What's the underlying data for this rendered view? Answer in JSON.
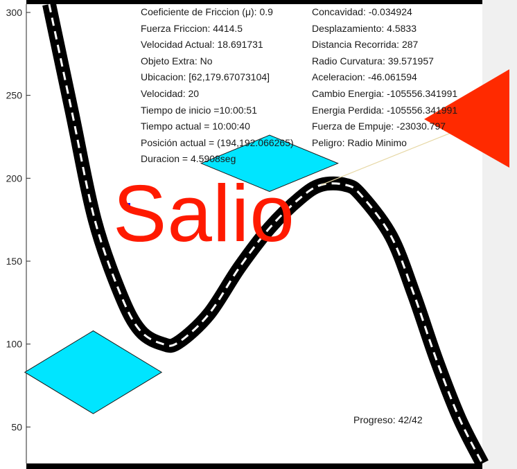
{
  "chart_data": {
    "type": "line",
    "title": "",
    "xlabel": "",
    "ylabel": "",
    "ylim": [
      28,
      305
    ],
    "yticks": [
      50,
      100,
      150,
      200,
      250,
      300
    ],
    "series": [
      {
        "x": [
          15,
          30,
          45,
          62,
          75,
          90,
          100,
          120,
          140,
          160,
          180,
          194,
          210,
          220,
          240,
          255,
          270,
          285,
          300
        ],
        "values": [
          305,
          240,
          175,
          130,
          108,
          100,
          101,
          118,
          146,
          170,
          188,
          196,
          196,
          190,
          165,
          130,
          90,
          55,
          28
        ]
      }
    ],
    "markers": [
      {
        "shape": "diamond",
        "color": "#00e5ff",
        "x_center": 160,
        "y_center": 209,
        "width": 90,
        "height": 34
      },
      {
        "shape": "diamond",
        "color": "#00e5ff",
        "x_center": 44,
        "y_center": 83,
        "width": 90,
        "height": 50
      },
      {
        "shape": "triangle",
        "color": "#ff2a00"
      }
    ]
  },
  "status_left": [
    "Coeficiente de Friccion (μ): 0.9",
    "Fuerza Friccion: 4414.5",
    "Velocidad Actual: 18.691731",
    "Objeto Extra: No",
    "Ubicacion: [62,179.67073104]",
    "Velocidad: 20",
    "Tiempo de inicio =10:00:51",
    "Tiempo actual = 10:00:40",
    "Posición actual = (194,192.066265)",
    "Duracion = 4.5908seg"
  ],
  "status_right": [
    "Concavidad: -0.034924",
    "Desplazamiento: 4.5833",
    "Distancia Recorrida: 287",
    "Radio Curvatura: 39.571957",
    "Aceleracion: -46.061594",
    "Cambio Energia: -105556.341991",
    "Energia Perdida: -105556.341991",
    "Fuerza de Empuje: -23030.797",
    "Peligro: Radio Minimo"
  ],
  "overlay_text": "Salio",
  "progress_text": "Progreso: 42/42",
  "colors": {
    "road": "#000000",
    "road_dash": "#ffffff",
    "diamond": "#00e5ff",
    "triangle": "#ff2a00",
    "salio": "#ff1a00",
    "sightline": "#e6d7a3"
  }
}
